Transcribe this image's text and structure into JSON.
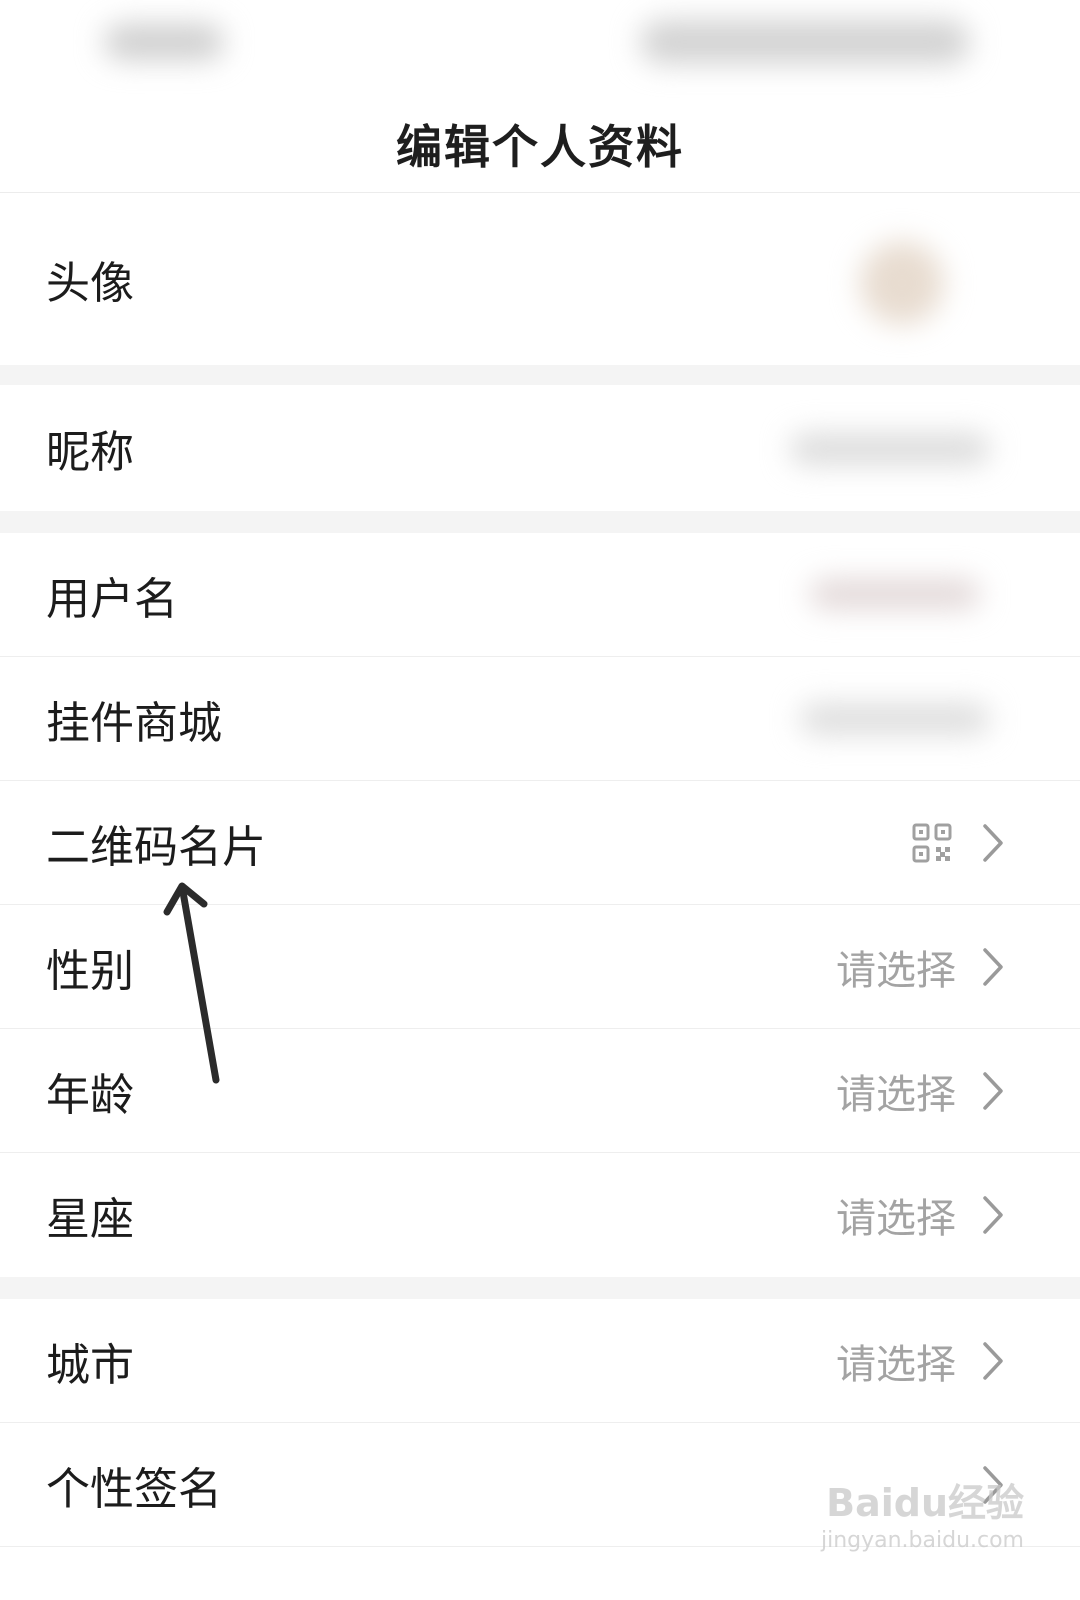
{
  "header": {
    "title": "编辑个人资料"
  },
  "rows": {
    "avatar": {
      "label": "头像"
    },
    "nickname": {
      "label": "昵称"
    },
    "username": {
      "label": "用户名"
    },
    "pendant_mall": {
      "label": "挂件商城"
    },
    "qr_card": {
      "label": "二维码名片",
      "icon": "qr-code-icon"
    },
    "gender": {
      "label": "性别",
      "value": "请选择"
    },
    "age": {
      "label": "年龄",
      "value": "请选择"
    },
    "zodiac": {
      "label": "星座",
      "value": "请选择"
    },
    "city": {
      "label": "城市",
      "value": "请选择"
    },
    "signature": {
      "label": "个性签名"
    }
  },
  "watermark": {
    "brand": "Baidu经验",
    "url": "jingyan.baidu.com"
  },
  "colors": {
    "chevron": "#9a9a9a",
    "value_text": "#a3a3a3",
    "divider": "#f4f4f4"
  }
}
